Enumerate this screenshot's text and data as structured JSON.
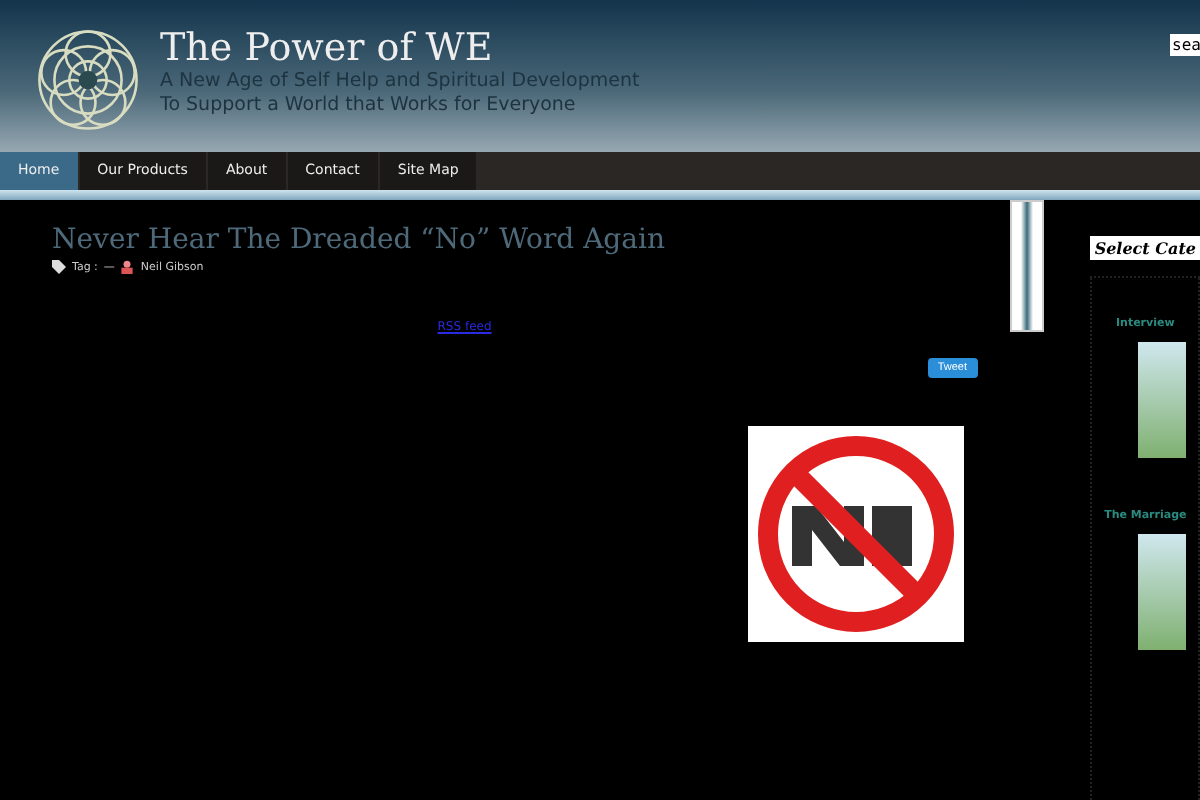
{
  "site": {
    "title": "The Power of WE",
    "tagline_1": "A New Age of Self Help and Spiritual Development",
    "tagline_2": "To Support a World that Works for Everyone",
    "search": {
      "value": "sea"
    }
  },
  "nav": [
    {
      "label": "Home",
      "selected": true
    },
    {
      "label": "Our Products",
      "selected": false
    },
    {
      "label": "About",
      "selected": false
    },
    {
      "label": "Contact",
      "selected": false
    },
    {
      "label": "Site Map",
      "selected": false
    }
  ],
  "post": {
    "title": "Never Hear The Dreaded “No” Word Again",
    "tag_label": "Tag :",
    "separator": "—",
    "author": "Neil Gibson",
    "rss": "RSS feed",
    "tweet": "Tweet"
  },
  "sidebar": {
    "heading": "Select Cate",
    "sections": [
      {
        "title": "Interview"
      },
      {
        "title": "The Marriage"
      }
    ]
  }
}
